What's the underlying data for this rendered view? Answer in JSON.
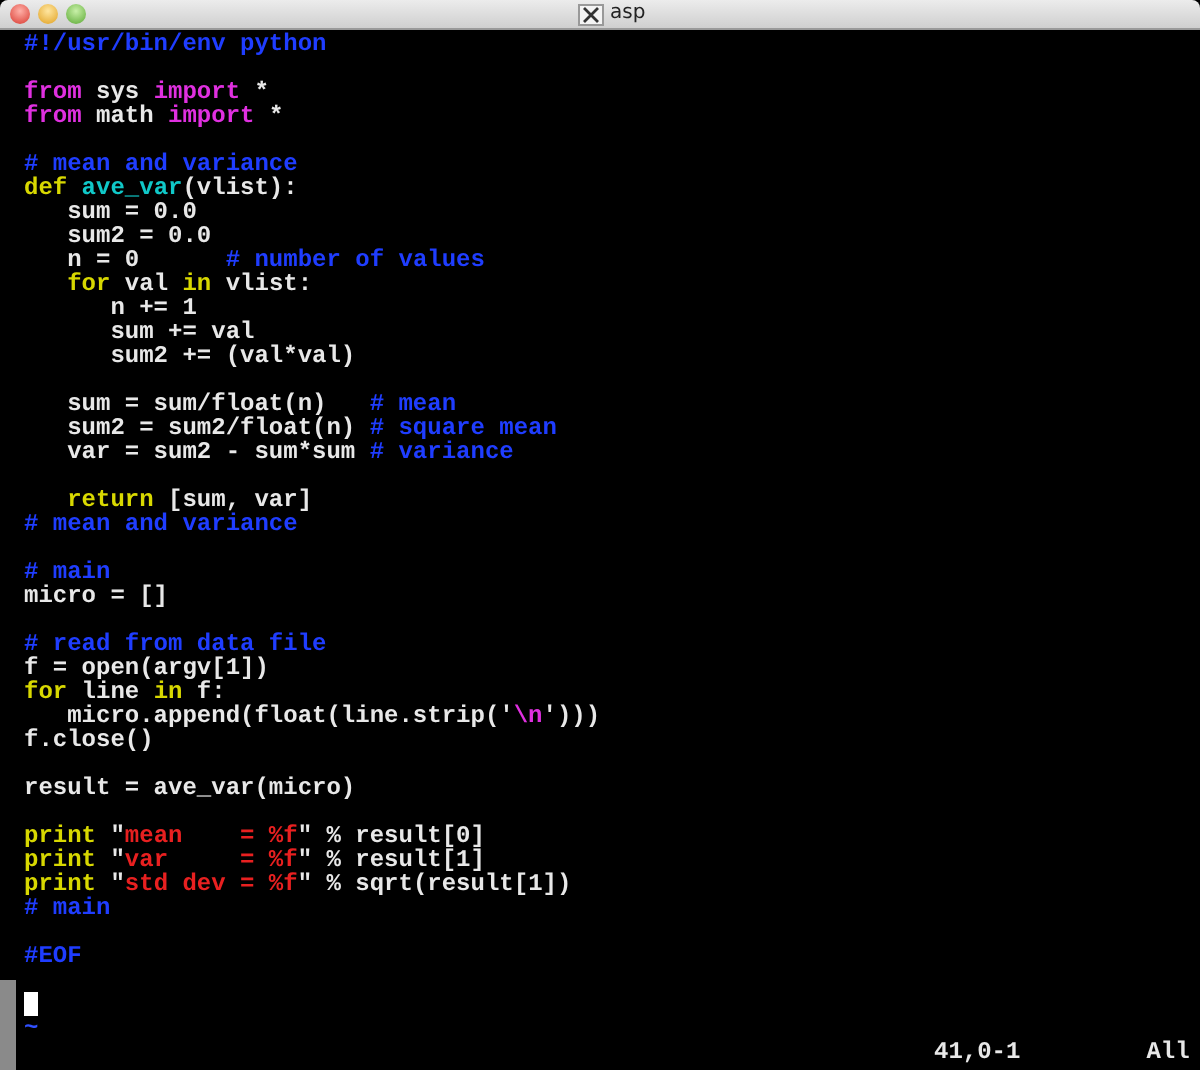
{
  "window": {
    "title": "asp"
  },
  "lines": [
    {
      "segments": [
        {
          "text": "#!/usr/bin/env python",
          "kind": "comment"
        }
      ]
    },
    {
      "blank_before": true,
      "segments": [
        {
          "text": "from",
          "kind": "include"
        },
        {
          "text": " sys ",
          "kind": "normal"
        },
        {
          "text": "import",
          "kind": "include"
        },
        {
          "text": " *",
          "kind": "normal"
        }
      ]
    },
    {
      "segments": [
        {
          "text": "from",
          "kind": "include"
        },
        {
          "text": " math ",
          "kind": "normal"
        },
        {
          "text": "import",
          "kind": "include"
        },
        {
          "text": " *",
          "kind": "normal"
        }
      ]
    },
    {
      "blank_before": true,
      "segments": [
        {
          "text": "# mean and variance",
          "kind": "comment"
        }
      ]
    },
    {
      "segments": [
        {
          "text": "def",
          "kind": "keyword"
        },
        {
          "text": " ave_var",
          "kind": "function"
        },
        {
          "text": "(vlist):",
          "kind": "normal"
        }
      ]
    },
    {
      "segments": [
        {
          "text": "   sum = 0.0",
          "kind": "normal"
        }
      ]
    },
    {
      "segments": [
        {
          "text": "   sum2 = 0.0",
          "kind": "normal"
        }
      ]
    },
    {
      "segments": [
        {
          "text": "   n = 0      ",
          "kind": "normal"
        },
        {
          "text": "# number of values",
          "kind": "comment"
        }
      ]
    },
    {
      "segments": [
        {
          "text": "   for",
          "kind": "keyword"
        },
        {
          "text": " val ",
          "kind": "normal"
        },
        {
          "text": "in",
          "kind": "keyword"
        },
        {
          "text": " vlist:",
          "kind": "normal"
        }
      ]
    },
    {
      "segments": [
        {
          "text": "      n += 1",
          "kind": "normal"
        }
      ]
    },
    {
      "segments": [
        {
          "text": "      sum += val",
          "kind": "normal"
        }
      ]
    },
    {
      "segments": [
        {
          "text": "      sum2 += (val*val)",
          "kind": "normal"
        }
      ]
    },
    {
      "blank_before": true,
      "segments": [
        {
          "text": "   sum = sum/float(n)   ",
          "kind": "normal"
        },
        {
          "text": "# mean",
          "kind": "comment"
        }
      ]
    },
    {
      "segments": [
        {
          "text": "   sum2 = sum2/float(n) ",
          "kind": "normal"
        },
        {
          "text": "# square mean",
          "kind": "comment"
        }
      ]
    },
    {
      "segments": [
        {
          "text": "   var = sum2 - sum*sum ",
          "kind": "normal"
        },
        {
          "text": "# variance",
          "kind": "comment"
        }
      ]
    },
    {
      "blank_before": true,
      "segments": [
        {
          "text": "   return",
          "kind": "keyword"
        },
        {
          "text": " [sum, var]",
          "kind": "normal"
        }
      ]
    },
    {
      "segments": [
        {
          "text": "# mean and variance",
          "kind": "comment"
        }
      ]
    },
    {
      "blank_before": true,
      "segments": [
        {
          "text": "# main",
          "kind": "comment"
        }
      ]
    },
    {
      "segments": [
        {
          "text": "micro = []",
          "kind": "normal"
        }
      ]
    },
    {
      "blank_before": true,
      "segments": [
        {
          "text": "# read from data file",
          "kind": "comment"
        }
      ]
    },
    {
      "segments": [
        {
          "text": "f = open(argv[1])",
          "kind": "normal"
        }
      ]
    },
    {
      "segments": [
        {
          "text": "for",
          "kind": "keyword"
        },
        {
          "text": " line ",
          "kind": "normal"
        },
        {
          "text": "in",
          "kind": "keyword"
        },
        {
          "text": " f:",
          "kind": "normal"
        }
      ]
    },
    {
      "segments": [
        {
          "text": "   micro.append(float(line.strip('",
          "kind": "normal"
        },
        {
          "text": "\\n",
          "kind": "special"
        },
        {
          "text": "')))",
          "kind": "normal"
        }
      ]
    },
    {
      "segments": [
        {
          "text": "f.close()",
          "kind": "normal"
        }
      ]
    },
    {
      "blank_before": true,
      "segments": [
        {
          "text": "result = ave_var(micro)",
          "kind": "normal"
        }
      ]
    },
    {
      "blank_before": true,
      "segments": [
        {
          "text": "print",
          "kind": "keyword"
        },
        {
          "text": " \"",
          "kind": "normal"
        },
        {
          "text": "mean    = %f",
          "kind": "string"
        },
        {
          "text": "\" % result[0]",
          "kind": "normal"
        }
      ]
    },
    {
      "segments": [
        {
          "text": "print",
          "kind": "keyword"
        },
        {
          "text": " \"",
          "kind": "normal"
        },
        {
          "text": "var     = %f",
          "kind": "string"
        },
        {
          "text": "\" % result[1]",
          "kind": "normal"
        }
      ]
    },
    {
      "segments": [
        {
          "text": "print",
          "kind": "keyword"
        },
        {
          "text": " \"",
          "kind": "normal"
        },
        {
          "text": "std dev = %f",
          "kind": "string"
        },
        {
          "text": "\" % sqrt(result[1])",
          "kind": "normal"
        }
      ]
    },
    {
      "segments": [
        {
          "text": "# main",
          "kind": "comment"
        }
      ]
    },
    {
      "blank_before": true,
      "segments": [
        {
          "text": "#EOF",
          "kind": "comment"
        }
      ]
    },
    {
      "blank_before": true,
      "cursor": true
    },
    {
      "segments": [
        {
          "text": "~",
          "kind": "nontext"
        }
      ]
    }
  ],
  "status": {
    "position": "41,0-1",
    "scroll": "All"
  }
}
